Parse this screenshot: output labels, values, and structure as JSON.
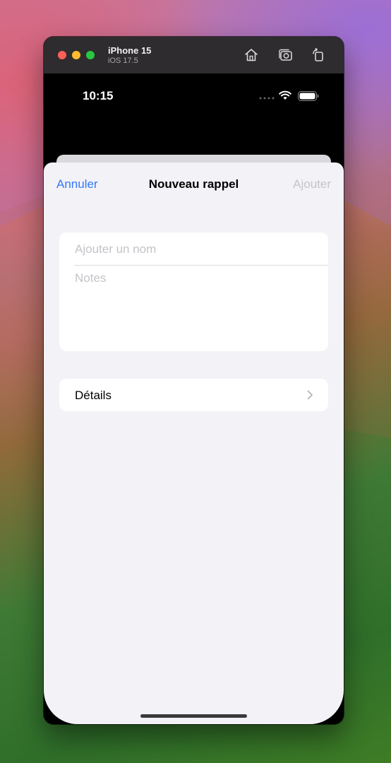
{
  "window": {
    "device_name": "iPhone 15",
    "os_version": "iOS 17.5"
  },
  "toolbar_icons": [
    "home-icon",
    "screenshot-icon",
    "rotate-icon"
  ],
  "status_bar": {
    "time": "10:15",
    "icons": [
      "cellular-dots-icon",
      "wifi-icon",
      "battery-icon"
    ]
  },
  "sheet": {
    "cancel_label": "Annuler",
    "title": "Nouveau rappel",
    "add_label": "Ajouter"
  },
  "form": {
    "name_placeholder": "Ajouter un nom",
    "name_value": "",
    "notes_placeholder": "Notes",
    "notes_value": ""
  },
  "details": {
    "label": "Détails"
  },
  "colors": {
    "accent": "#3478f6",
    "disabled": "#c4c4c9",
    "sheet_background": "#f2f2f7"
  }
}
